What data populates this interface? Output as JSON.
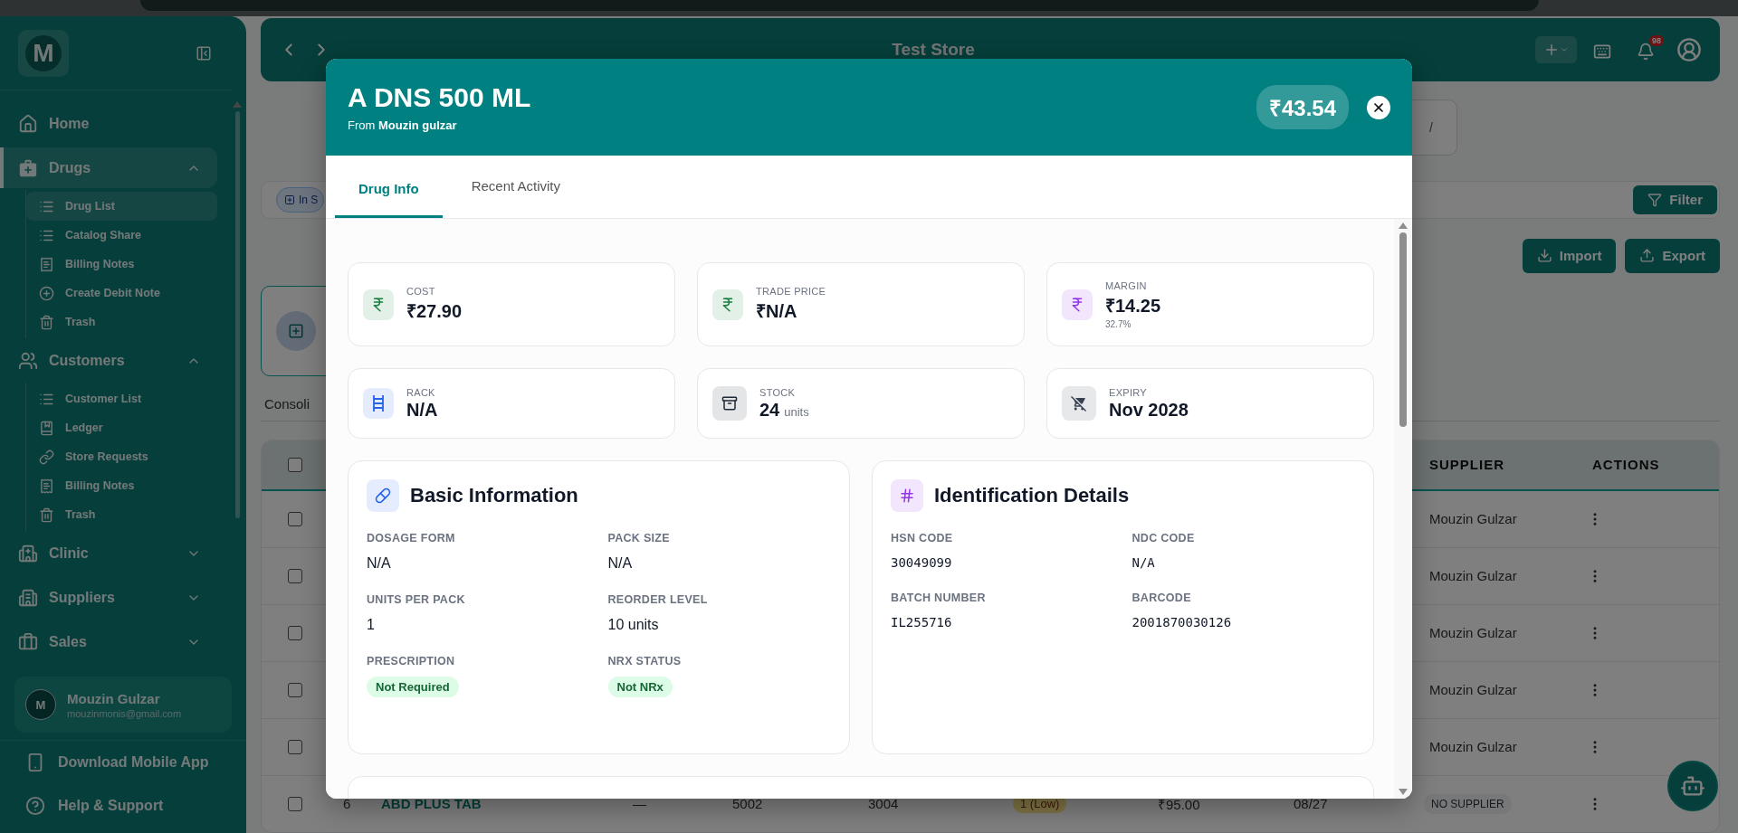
{
  "sidebar": {
    "logo": "M",
    "nav": [
      {
        "kind": "link",
        "label": "Home",
        "selected": false
      },
      {
        "kind": "group",
        "label": "Drugs",
        "selected": true,
        "expanded": true,
        "children": [
          {
            "label": "Drug List",
            "selected": true
          },
          {
            "label": "Catalog Share",
            "selected": false
          },
          {
            "label": "Billing Notes",
            "selected": false
          },
          {
            "label": "Create Debit Note",
            "selected": false
          },
          {
            "label": "Trash",
            "selected": false
          }
        ]
      },
      {
        "kind": "group",
        "label": "Customers",
        "selected": false,
        "expanded": true,
        "children": [
          {
            "label": "Customer List",
            "selected": false
          },
          {
            "label": "Ledger",
            "selected": false
          },
          {
            "label": "Store Requests",
            "selected": false
          },
          {
            "label": "Billing Notes",
            "selected": false
          },
          {
            "label": "Trash",
            "selected": false
          }
        ]
      },
      {
        "kind": "group",
        "label": "Clinic",
        "selected": false,
        "expanded": false
      },
      {
        "kind": "group",
        "label": "Suppliers",
        "selected": false,
        "expanded": false
      },
      {
        "kind": "group",
        "label": "Sales",
        "selected": false,
        "expanded": false
      }
    ],
    "user": {
      "initial": "M",
      "name": "Mouzin Gulzar",
      "email": "mouzinmonis@gmail.com"
    },
    "footer": [
      "Download Mobile App",
      "Help & Support"
    ]
  },
  "header": {
    "title": "Test Store",
    "notifications": "98"
  },
  "page": {
    "breadcrumb_separator": "/",
    "filter_chip": "In S",
    "filter_button": "Filter",
    "import_button": "Import",
    "export_button": "Export",
    "view_tab": "Consoli",
    "table": {
      "columns": [
        "SUPPLIER",
        "ACTIONS"
      ],
      "header_checked": false,
      "rows": [
        {
          "checked": false,
          "supplier": "Mouzin Gulzar",
          "supplier_tag": false
        },
        {
          "checked": false,
          "supplier": "Mouzin Gulzar",
          "supplier_tag": false
        },
        {
          "checked": false,
          "supplier": "Mouzin Gulzar",
          "supplier_tag": false
        },
        {
          "checked": false,
          "supplier": "Mouzin Gulzar",
          "supplier_tag": false
        },
        {
          "checked": false,
          "supplier": "Mouzin Gulzar",
          "supplier_tag": false
        },
        {
          "checked": false,
          "number": "6",
          "name": "ABD PLUS TAB",
          "column_3": "—",
          "column_4": "5002",
          "column_5": "3004",
          "column_6": "1 (Low)",
          "column_7": "₹95.00",
          "column_8": "08/27",
          "supplier": "NO SUPPLIER",
          "supplier_tag": true
        }
      ]
    }
  },
  "modal": {
    "title": "A DNS 500 ML",
    "subtitle": "From **Mouzin gulzar**",
    "price": "₹43.54",
    "tabs": [
      {
        "label": "Drug Info",
        "selected": true
      },
      {
        "label": "Recent Activity",
        "selected": false
      }
    ],
    "stats": [
      {
        "label": "COST",
        "value": "₹27.90",
        "color": "#15803d"
      },
      {
        "label": "TRADE PRICE",
        "value": "₹N/A",
        "color": "#15803d"
      },
      {
        "label": "MARGIN",
        "value": "₹14.25",
        "note": "32.7%",
        "color": "#9333ea"
      },
      {
        "label": "RACK",
        "value": "N/A",
        "color": "#2563eb"
      },
      {
        "label": "STOCK",
        "value": "24",
        "unit": "units",
        "color": "#1f2937"
      },
      {
        "label": "EXPIRY",
        "value": "Nov 2028",
        "color": "#374151"
      }
    ],
    "sections": [
      {
        "title": "Basic Information",
        "color": "#2563eb",
        "fields": [
          {
            "label": "DOSAGE FORM",
            "value": "N/A",
            "kind": "text"
          },
          {
            "label": "PACK SIZE",
            "value": "N/A",
            "kind": "text"
          },
          {
            "label": "UNITS PER PACK",
            "value": "1",
            "kind": "text"
          },
          {
            "label": "REORDER LEVEL",
            "value": "10 units",
            "kind": "text"
          },
          {
            "label": "PRESCRIPTION",
            "value": "Not Required",
            "kind": "pill"
          },
          {
            "label": "NRX STATUS",
            "value": "Not NRx",
            "kind": "pill"
          }
        ]
      },
      {
        "title": "Identification Details",
        "color": "#9333ea",
        "fields": [
          {
            "label": "HSN CODE",
            "value": "30049099",
            "kind": "code"
          },
          {
            "label": "NDC CODE",
            "value": "N/A",
            "kind": "code"
          },
          {
            "label": "BATCH NUMBER",
            "value": "IL255716",
            "kind": "code"
          },
          {
            "label": "BARCODE",
            "value": "2001870030126",
            "kind": "code"
          }
        ]
      }
    ]
  }
}
